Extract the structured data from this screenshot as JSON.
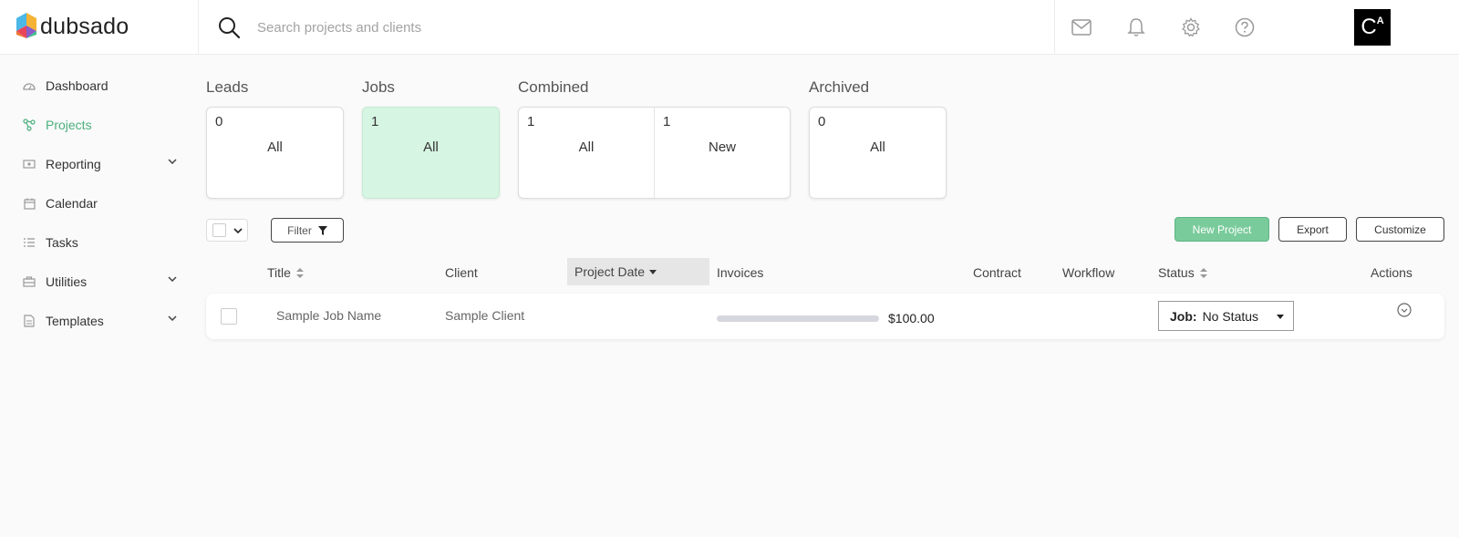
{
  "app": {
    "name": "dubsado"
  },
  "search": {
    "placeholder": "Search projects and clients"
  },
  "topbar": {
    "icons": [
      "mail-icon",
      "bell-icon",
      "gear-icon",
      "help-icon"
    ],
    "avatar_text": "C",
    "avatar_sup": "A"
  },
  "sidebar": {
    "items": [
      {
        "label": "Dashboard",
        "icon": "dashboard-icon",
        "active": false,
        "expandable": false
      },
      {
        "label": "Projects",
        "icon": "projects-icon",
        "active": true,
        "expandable": false
      },
      {
        "label": "Reporting",
        "icon": "reporting-icon",
        "active": false,
        "expandable": true
      },
      {
        "label": "Calendar",
        "icon": "calendar-icon",
        "active": false,
        "expandable": false
      },
      {
        "label": "Tasks",
        "icon": "tasks-icon",
        "active": false,
        "expandable": false
      },
      {
        "label": "Utilities",
        "icon": "utilities-icon",
        "active": false,
        "expandable": true
      },
      {
        "label": "Templates",
        "icon": "templates-icon",
        "active": false,
        "expandable": true
      }
    ]
  },
  "stats": {
    "leads": {
      "label": "Leads",
      "cells": [
        {
          "count": "0",
          "name": "All"
        }
      ]
    },
    "jobs": {
      "label": "Jobs",
      "cells": [
        {
          "count": "1",
          "name": "All"
        }
      ]
    },
    "combined": {
      "label": "Combined",
      "cells": [
        {
          "count": "1",
          "name": "All"
        },
        {
          "count": "1",
          "name": "New"
        }
      ]
    },
    "archived": {
      "label": "Archived",
      "cells": [
        {
          "count": "0",
          "name": "All"
        }
      ]
    }
  },
  "toolbar": {
    "filter_label": "Filter",
    "new_project_label": "New Project",
    "export_label": "Export",
    "customize_label": "Customize"
  },
  "table": {
    "headers": {
      "title": "Title",
      "client": "Client",
      "project_date": "Project Date",
      "invoices": "Invoices",
      "contract": "Contract",
      "workflow": "Workflow",
      "status": "Status",
      "actions": "Actions"
    },
    "rows": [
      {
        "title": "Sample Job Name",
        "client": "Sample Client",
        "invoice_progress": 0,
        "invoice_amount": "$100.00",
        "status_prefix": "Job:",
        "status_value": "No Status"
      }
    ]
  },
  "colors": {
    "accent_green": "#4caf7d",
    "jobs_card_bg": "#d6f5e2",
    "new_project_bg": "#7acb9b"
  }
}
